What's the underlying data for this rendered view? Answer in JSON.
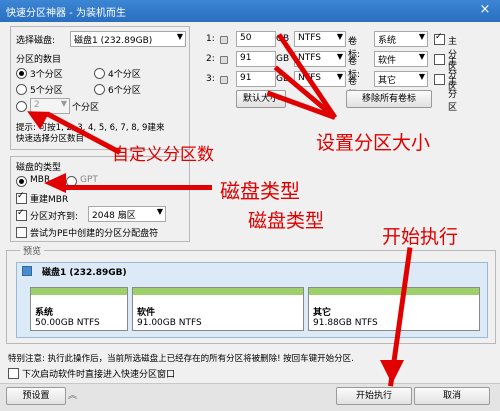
{
  "window": {
    "title": "快速分区神器 - 为装机而生",
    "close_icon": "×"
  },
  "disk_select": {
    "label": "选择磁盘:",
    "value": "磁盘1 (232.89GB)"
  },
  "partition_count": {
    "label": "分区的数目",
    "options": [
      "3个分区",
      "4个分区",
      "5个分区",
      "6个分区"
    ],
    "custom_value": "2",
    "custom_suffix": "个分区",
    "hint_line1": "提示: 可按1, 2, 3, 4, 5, 6, 7, 8, 9建来",
    "hint_line2": "快速选择分区数目"
  },
  "disk_type": {
    "label": "磁盘的类型",
    "mbr": "MBR",
    "gpt": "GPT",
    "rebuild_mbr": "重建MBR",
    "align_label": "分区对齐到:",
    "align_value": "2048 扇区",
    "pe_assign": "尝试为PE中创建的分区分配盘符"
  },
  "partitions": [
    {
      "num": "1:",
      "size": "50",
      "unit": "GB",
      "fs": "NTFS",
      "label_key": "卷标:",
      "label": "系统",
      "primary": "主分区"
    },
    {
      "num": "2:",
      "size": "91",
      "unit": "GB",
      "fs": "NTFS",
      "label_key": "卷标:",
      "label": "软件",
      "primary": "主分区"
    },
    {
      "num": "3:",
      "size": "91",
      "unit": "GB",
      "fs": "NTFS",
      "label_key": "卷标:",
      "label": "其它",
      "primary": "主分区"
    }
  ],
  "buttons": {
    "default_size": "默认大小",
    "remove_labels": "移除所有卷标",
    "preset": "预设置",
    "start": "开始执行",
    "cancel": "取消"
  },
  "preview": {
    "label": "预览",
    "disk_name": "磁盘1 (232.89GB)",
    "parts": [
      {
        "name": "系统",
        "info": "50.00GB NTFS"
      },
      {
        "name": "软件",
        "info": "91.00GB NTFS"
      },
      {
        "name": "其它",
        "info": "91.88GB NTFS"
      }
    ]
  },
  "notice": "特别注意: 执行此操作后，当前所选磁盘上已经存在的所有分区将被删除! 按回车键开始分区.",
  "next_start_label": "下次启动软件时直接进入快速分区窗口",
  "annotations": {
    "custom_count": "自定义分区数",
    "set_size": "设置分区大小",
    "disk_type_1": "磁盘类型",
    "disk_type_2": "磁盘类型",
    "start": "开始执行"
  },
  "colors": {
    "annotation": "#e00000",
    "titlebar": "#2a6fc0",
    "partition_bar": "#9dd06a"
  }
}
